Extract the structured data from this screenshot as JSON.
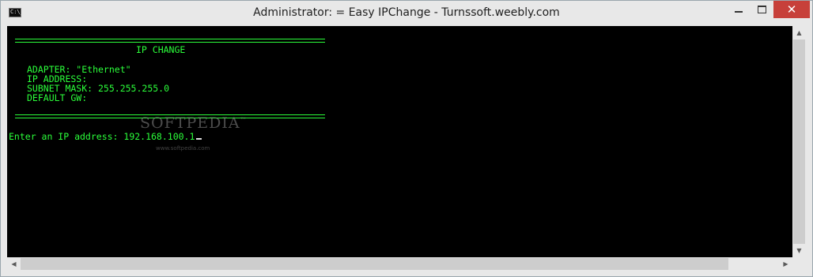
{
  "window": {
    "title": "Administrator: = Easy IPChange - Turnssoft.weebly.com",
    "icon_label": "C:\\_",
    "close_glyph": "✕"
  },
  "console": {
    "heading": "IP CHANGE",
    "adapter": "ADAPTER: \"Ethernet\"",
    "ip_address": "IP ADDRESS:",
    "subnet_mask": "SUBNET MASK: 255.255.255.0",
    "default_gw": "DEFAULT GW:",
    "prompt": "Enter an IP address: 192.168.100.1"
  },
  "watermark": {
    "text": "SOFTPEDIA",
    "trademark": "™",
    "sub": "www.softpedia.com"
  },
  "colors": {
    "console_background": "#000000",
    "console_text": "#2bff3a",
    "close_button": "#c7403a",
    "chrome": "#e8e8e8"
  },
  "icons": [
    "cmd-icon",
    "minimize-icon",
    "maximize-icon",
    "close-icon",
    "scroll-up-icon",
    "scroll-down-icon",
    "scroll-left-icon",
    "scroll-right-icon"
  ]
}
